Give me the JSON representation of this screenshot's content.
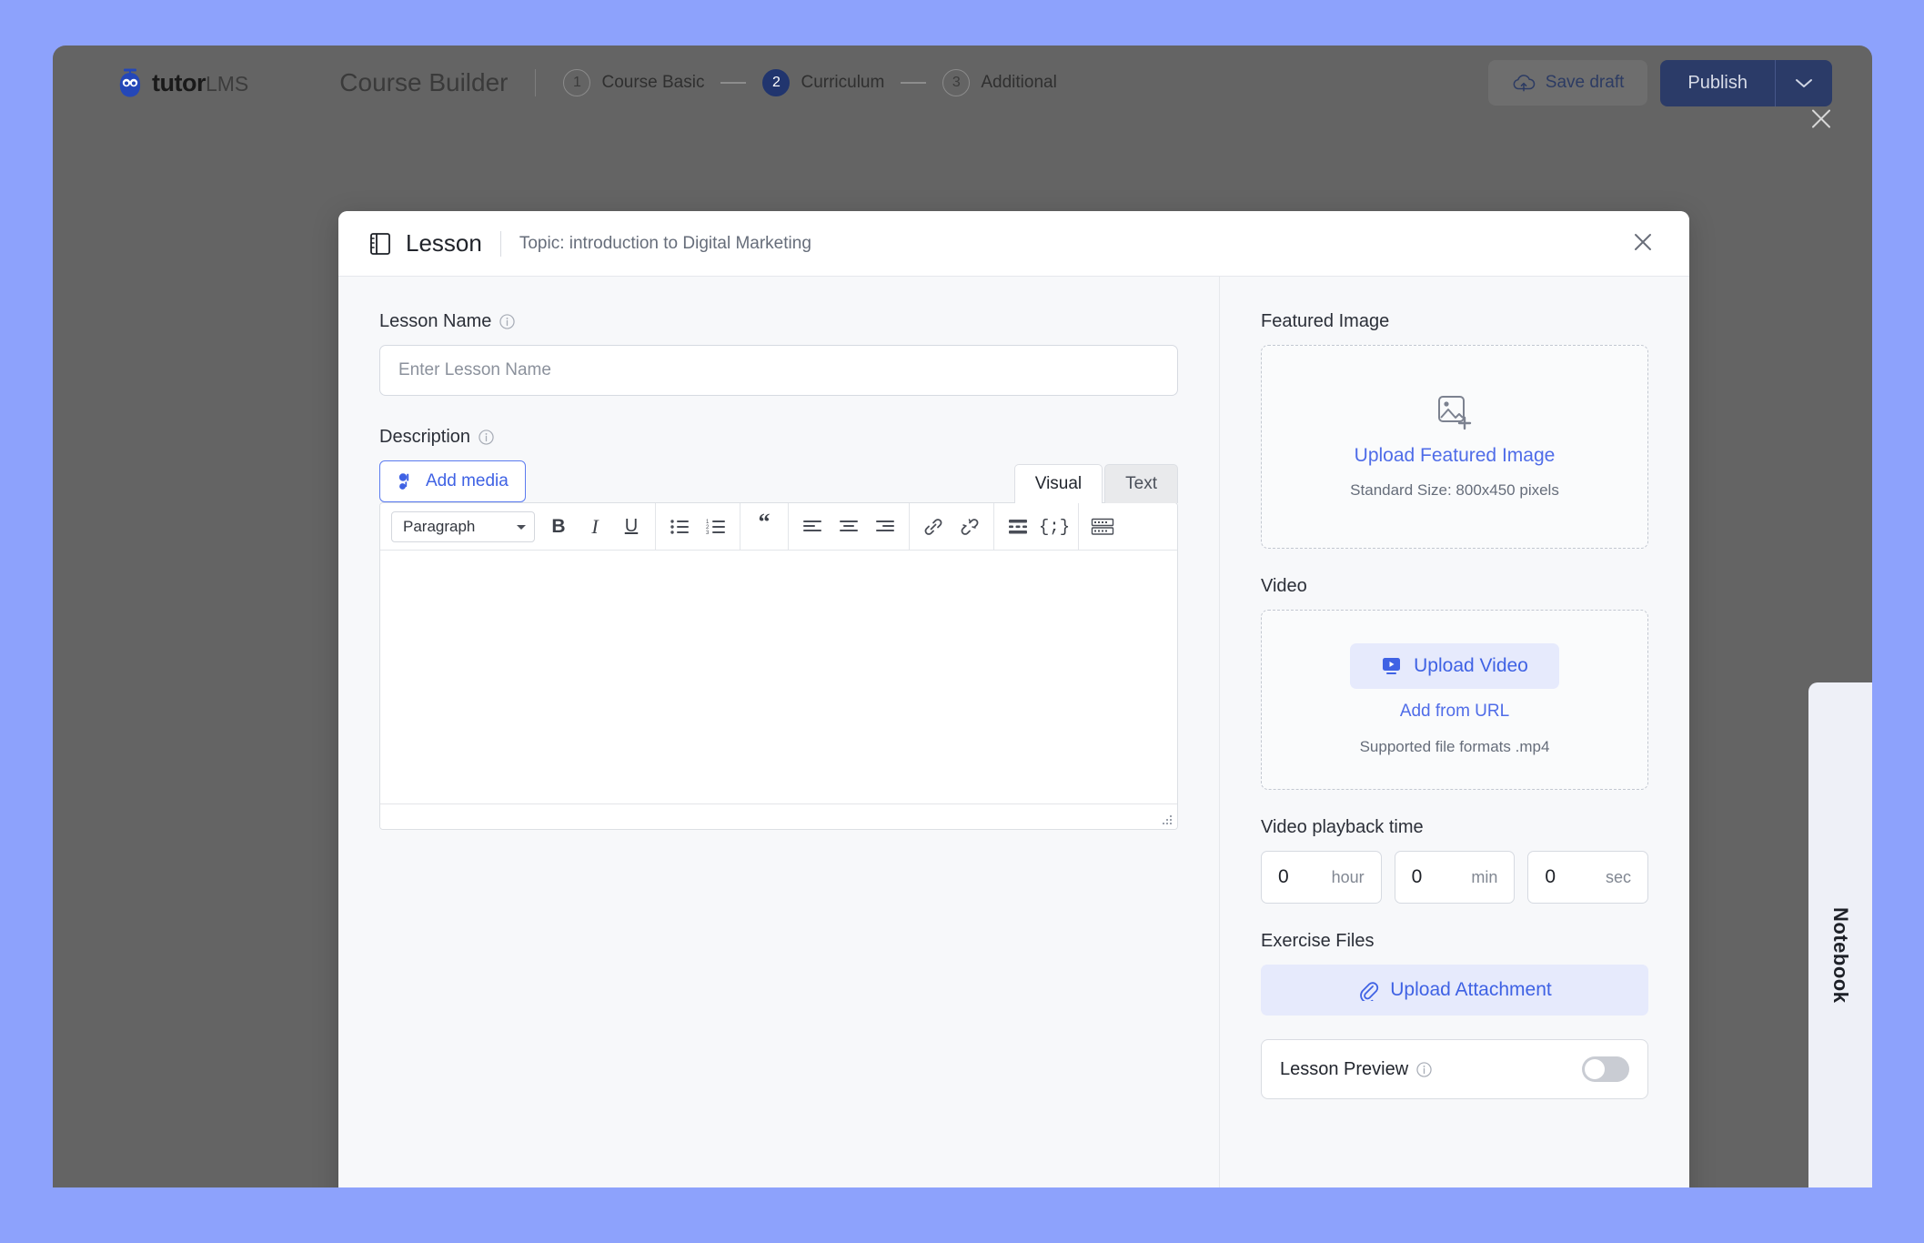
{
  "colors": {
    "page_background": "#8da2fc",
    "app_background": "#646464",
    "accent_blue": "#3f62e4",
    "link_blue": "#4f6ce8",
    "publish_navy": "#2b3b68",
    "modal_background": "#f7f8fa"
  },
  "topbar": {
    "logo_name": "tutor",
    "logo_suffix": "LMS",
    "builder_title": "Course Builder",
    "steps": [
      {
        "num": "1",
        "label": "Course Basic",
        "active": false
      },
      {
        "num": "2",
        "label": "Curriculum",
        "active": true
      },
      {
        "num": "3",
        "label": "Additional",
        "active": false
      }
    ],
    "save_draft_label": "Save draft",
    "publish_label": "Publish"
  },
  "modal": {
    "title": "Lesson",
    "subtitle": "Topic: introduction to Digital Marketing"
  },
  "left_pane": {
    "lesson_name_label": "Lesson Name",
    "lesson_name_placeholder": "Enter Lesson Name",
    "lesson_name_value": "",
    "description_label": "Description",
    "add_media_label": "Add media",
    "tabs": [
      {
        "label": "Visual",
        "active": true
      },
      {
        "label": "Text",
        "active": false
      }
    ],
    "editor": {
      "format_select_value": "Paragraph",
      "content": "",
      "toolbar": [
        "bold-icon",
        "italic-icon",
        "underline-icon",
        "bulleted-list-icon",
        "numbered-list-icon",
        "blockquote-icon",
        "align-left-icon",
        "align-center-icon",
        "align-right-icon",
        "link-icon",
        "unlink-icon",
        "read-more-icon",
        "code-icon",
        "toolbar-toggle-icon"
      ],
      "bold_label": "B",
      "italic_label": "I",
      "underline_label": "U",
      "quote_label": "“",
      "code_label": "{;}"
    }
  },
  "right_pane": {
    "featured_image": {
      "label": "Featured Image",
      "upload_label": "Upload Featured Image",
      "hint": "Standard Size: 800x450 pixels"
    },
    "video": {
      "label": "Video",
      "upload_label": "Upload Video",
      "add_from_url_label": "Add from URL",
      "hint": "Supported file formats .mp4"
    },
    "playback": {
      "label": "Video playback time",
      "fields": [
        {
          "value": "0",
          "unit": "hour"
        },
        {
          "value": "0",
          "unit": "min"
        },
        {
          "value": "0",
          "unit": "sec"
        }
      ]
    },
    "exercise_files": {
      "label": "Exercise Files",
      "upload_label": "Upload Attachment"
    },
    "lesson_preview": {
      "label": "Lesson Preview",
      "enabled": false
    }
  },
  "notebook": {
    "label": "Notebook"
  }
}
